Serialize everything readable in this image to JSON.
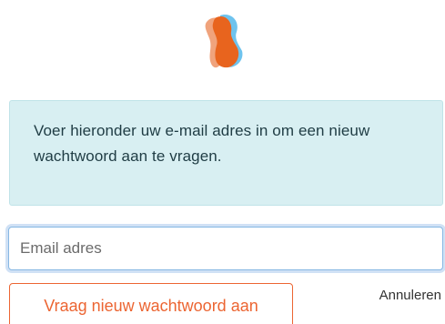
{
  "logo": {
    "icon": "butterfly-logo-icon",
    "colors": {
      "back_wing": "#f0a37c",
      "front_wing": "#e8641e",
      "shadow": "#6ec3ee"
    }
  },
  "info": {
    "text": "Voer hieronder uw e-mail adres in om een nieuw wachtwoord aan te vragen.",
    "background": "#d8eff2"
  },
  "form": {
    "email_placeholder": "Email adres",
    "submit_label": "Vraag nieuw wachtwoord aan",
    "cancel_label": "Annuleren",
    "accent_color": "#ec6532"
  }
}
